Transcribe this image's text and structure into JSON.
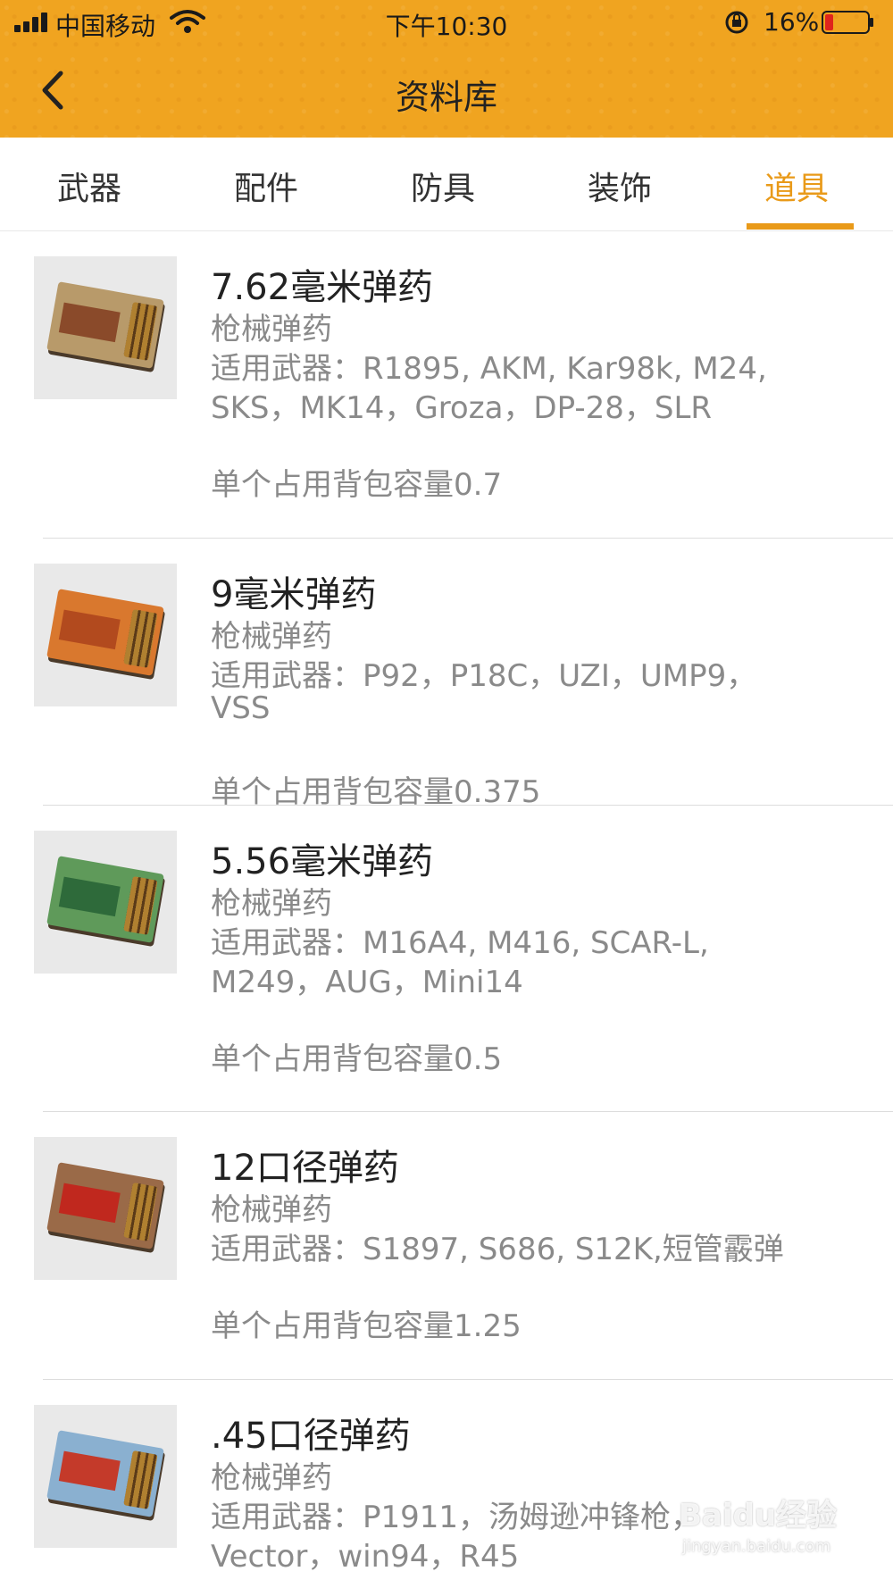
{
  "status_bar": {
    "carrier": "中国移动",
    "time": "下午10:30",
    "battery": "16%"
  },
  "header": {
    "title": "资料库"
  },
  "tabs": [
    {
      "label": "武器",
      "active": false
    },
    {
      "label": "配件",
      "active": false
    },
    {
      "label": "防具",
      "active": false
    },
    {
      "label": "装饰",
      "active": false
    },
    {
      "label": "道具",
      "active": true
    }
  ],
  "items": [
    {
      "title": "7.62毫米弹药",
      "category": "枪械弹药",
      "weapons_line1": "适用武器：R1895, AKM, Kar98k, M24,",
      "weapons_line2": "SKS，MK14，Groza，DP-28，SLR",
      "capacity": "单个占用背包容量0.7",
      "box_color": "#b89a6a",
      "stripe_color": "#8a4a2a"
    },
    {
      "title": "9毫米弹药",
      "category": "枪械弹药",
      "weapons_line1": "适用武器：P92，P18C，UZI，UMP9，",
      "weapons_line2": "VSS",
      "capacity": "单个占用背包容量0.375",
      "box_color": "#d9782e",
      "stripe_color": "#b24a1e"
    },
    {
      "title": "5.56毫米弹药",
      "category": "枪械弹药",
      "weapons_line1": "适用武器：M16A4, M416, SCAR-L,",
      "weapons_line2": "M249，AUG，Mini14",
      "capacity": "单个占用背包容量0.5",
      "box_color": "#5f9a5a",
      "stripe_color": "#2e6a3a"
    },
    {
      "title": "12口径弹药",
      "category": "枪械弹药",
      "weapons_line1": "适用武器：S1897, S686, S12K,短管霰弹",
      "weapons_line2": "",
      "capacity": "单个占用背包容量1.25",
      "box_color": "#9a6a48",
      "stripe_color": "#c0281e"
    },
    {
      "title": ".45口径弹药",
      "category": "枪械弹药",
      "weapons_line1": "适用武器：P1911，汤姆逊冲锋枪，",
      "weapons_line2": "Vector，win94，R45",
      "capacity": "",
      "box_color": "#8ab0d0",
      "stripe_color": "#c43a2a"
    }
  ],
  "watermark": {
    "main": "Baidu经验",
    "sub": "jingyan.baidu.com"
  }
}
